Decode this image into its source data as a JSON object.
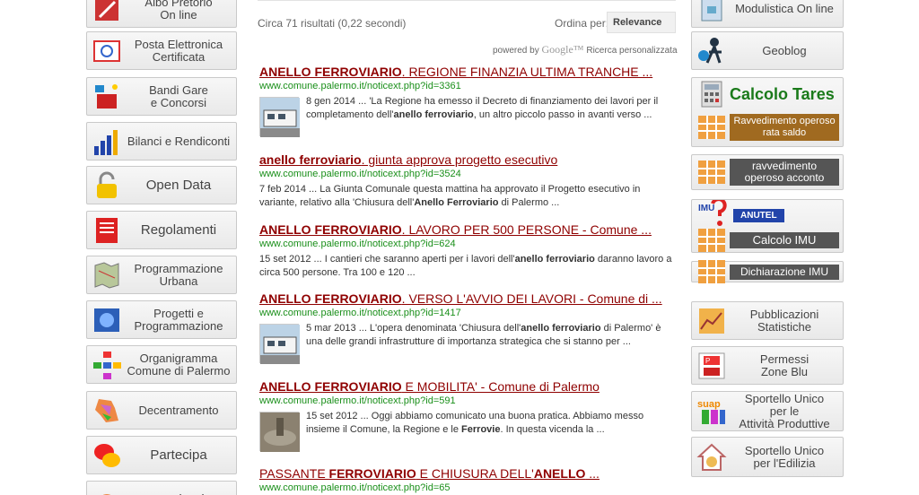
{
  "search": {
    "count": "Circa 71 risultati (0,22 secondi)",
    "order_label": "Ordina per:",
    "order_value": "Relevance",
    "powered_by": "powered by",
    "google": "Google™",
    "custom_search": "Ricerca personalizzata"
  },
  "left_menu": [
    {
      "label": "Albo Pretorio\nOn line",
      "icon": "albo-icon"
    },
    {
      "label": "Posta Elettronica\nCertificata",
      "icon": "email-icon"
    },
    {
      "label": "Bandi Gare\ne Concorsi",
      "icon": "briefcase-icon"
    },
    {
      "label": "Bilanci e Rendiconti",
      "icon": "bar-chart-icon"
    },
    {
      "label": "Open Data",
      "icon": "lock-icon"
    },
    {
      "label": "Regolamenti",
      "icon": "document-icon"
    },
    {
      "label": "Programmazione\nUrbana",
      "icon": "map-icon"
    },
    {
      "label": "Progetti e\nProgrammazione",
      "icon": "globe-icon"
    },
    {
      "label": "Organigramma\nComune di Palermo",
      "icon": "org-chart-icon"
    },
    {
      "label": "Decentramento",
      "icon": "district-map-icon"
    },
    {
      "label": "Partecipa",
      "icon": "speech-bubbles-icon"
    },
    {
      "label": "Le Aziende",
      "icon": "company-icon"
    }
  ],
  "right_menu": [
    {
      "label": "Modulistica On line",
      "icon": "forms-icon"
    },
    {
      "label": "Geoblog",
      "icon": "person-globe-icon"
    },
    {
      "label": "Calcolo Tares",
      "icon": "calculator-icon",
      "sub": "Ravvedimento operoso\nrata saldo"
    },
    {
      "label": "ravvedimento\noperoso acconto",
      "icon": "grid-icon"
    },
    {
      "label": "Calcolo IMU",
      "icon": "imu-icon",
      "badge": "ANUTEL"
    },
    {
      "label": "Dichiarazione IMU",
      "icon": "grid-icon"
    },
    {
      "label": "Pubblicazioni\nStatistiche",
      "icon": "stats-icon"
    },
    {
      "label": "Permessi\nZone Blu",
      "icon": "parking-icon"
    },
    {
      "label": "Sportello Unico\nper le\nAttività Produttive",
      "icon": "suap-icon"
    },
    {
      "label": "Sportello Unico\nper l'Edilizia",
      "icon": "house-icon"
    }
  ],
  "results": [
    {
      "title_parts": [
        [
          "ANELLO FERROVIARIO",
          true
        ],
        [
          ". REGIONE FINANZIA ULTIMA TRANCHE ...",
          false
        ]
      ],
      "url": "www.comune.palermo.it/noticext.php?id=3361",
      "thumb": "tram",
      "snippet": [
        [
          "8 gen 2014 ... 'La Regione ha emesso il Decreto di finanziamento dei lavori per il completamento dell'",
          false
        ],
        [
          "anello ferroviario",
          true
        ],
        [
          ", un altro piccolo passo in avanti verso ...",
          false
        ]
      ]
    },
    {
      "title_parts": [
        [
          "anello ferroviario",
          true
        ],
        [
          ". giunta approva progetto esecutivo",
          false
        ]
      ],
      "url": "www.comune.palermo.it/noticext.php?id=3524",
      "thumb": "",
      "snippet": [
        [
          "7 feb 2014 ... La Giunta Comunale questa mattina ha approvato il Progetto esecutivo in variante, relativo alla 'Chiusura dell'",
          false
        ],
        [
          "Anello Ferroviario",
          true
        ],
        [
          " di Palermo ...",
          false
        ]
      ]
    },
    {
      "title_parts": [
        [
          "ANELLO FERROVIARIO",
          true
        ],
        [
          ". LAVORO PER 500 PERSONE - Comune ...",
          false
        ]
      ],
      "url": "www.comune.palermo.it/noticext.php?id=624",
      "thumb": "",
      "snippet": [
        [
          "15 set 2012 ... I cantieri che saranno aperti per i lavori dell'",
          false
        ],
        [
          "anello ferroviario",
          true
        ],
        [
          " daranno lavoro a circa 500 persone. Tra 100 e 120 ...",
          false
        ]
      ]
    },
    {
      "title_parts": [
        [
          "ANELLO FERROVIARIO",
          true
        ],
        [
          ". VERSO L'AVVIO DEI LAVORI - Comune di ...",
          false
        ]
      ],
      "url": "www.comune.palermo.it/noticext.php?id=1417",
      "thumb": "tram",
      "snippet": [
        [
          "5 mar 2013 ... L'opera denominata 'Chiusura dell'",
          false
        ],
        [
          "anello ferroviario",
          true
        ],
        [
          " di Palermo' è una delle grandi infrastrutture di importanza strategica che si stanno per ...",
          false
        ]
      ]
    },
    {
      "title_parts": [
        [
          "ANELLO FERROVIARIO",
          true
        ],
        [
          " E MOBILITA' - Comune di Palermo",
          false
        ]
      ],
      "url": "www.comune.palermo.it/noticext.php?id=591",
      "thumb": "square",
      "snippet": [
        [
          "15 set 2012 ... Oggi abbiamo comunicato una buona pratica. Abbiamo messo insieme il Comune, la Regione e le ",
          false
        ],
        [
          "Ferrovie",
          true
        ],
        [
          ". In questa vicenda la ...",
          false
        ]
      ]
    },
    {
      "title_parts": [
        [
          "PASSANTE ",
          false
        ],
        [
          "FERROVIARIO",
          true
        ],
        [
          " E CHIUSURA DELL'",
          false
        ],
        [
          "ANELLO",
          true
        ],
        [
          " ...",
          false
        ]
      ],
      "url": "www.comune.palermo.it/noticext.php?id=65",
      "thumb": "",
      "snippet": []
    }
  ]
}
